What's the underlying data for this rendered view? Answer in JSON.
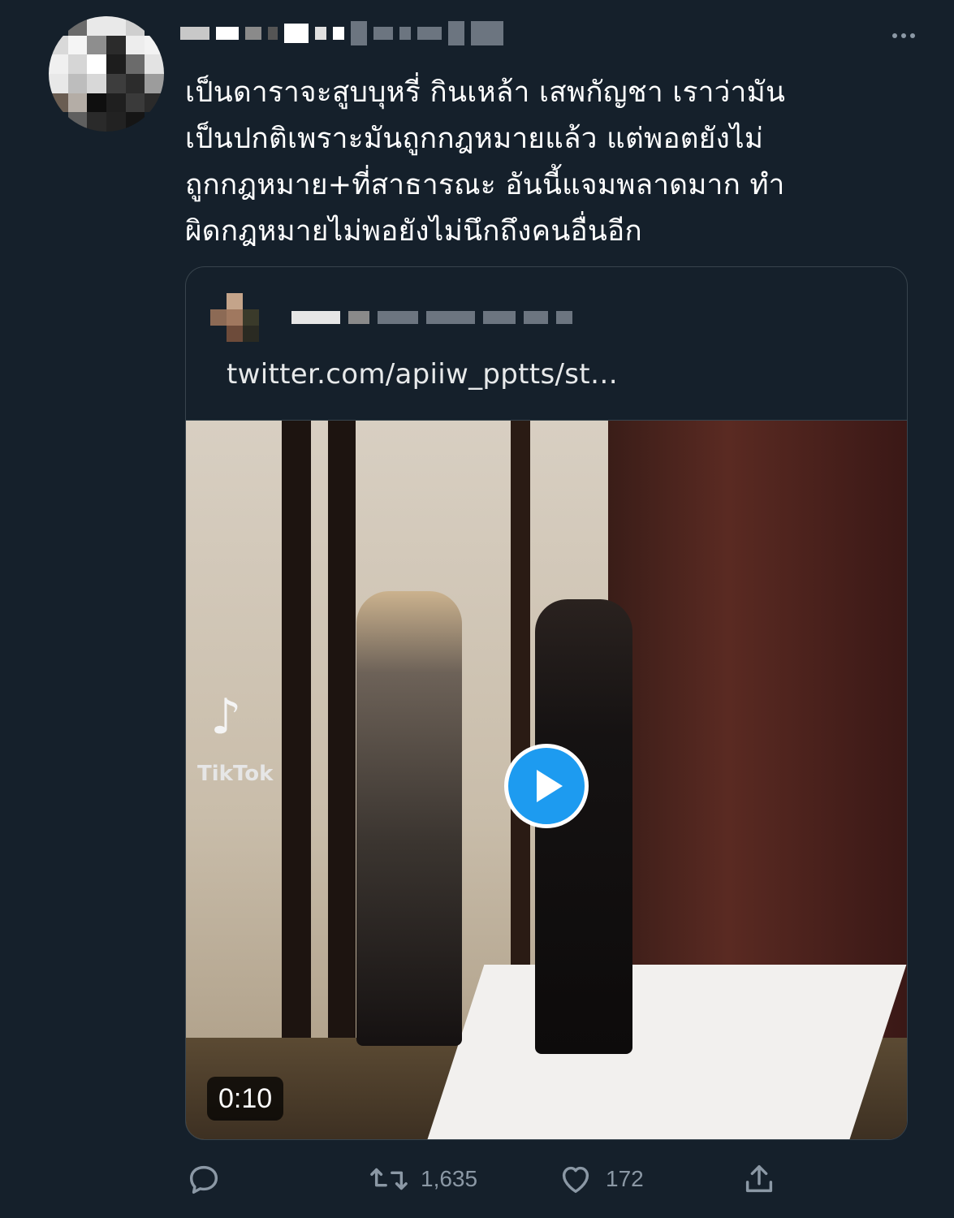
{
  "tweet": {
    "text": "เป็นดาราจะสูบบุหรี่ กินเหล้า เสพกัญชา เราว่ามัน\nเป็นปกติเพราะมันถูกกฎหมายแล้ว แต่พอตยังไม่\nถูกกฎหมาย+ที่สาธารณะ อันนี้แจมพลาดมาก ทำ\nผิดกฎหมายไม่พอยังไม่นึกถึงคนอื่นอีก"
  },
  "quote": {
    "link": "twitter.com/apiiw_pptts/st…",
    "video": {
      "duration": "0:10",
      "watermark_app": "TikTok"
    }
  },
  "actions": {
    "retweets": "1,635",
    "likes": "172"
  },
  "icons": {
    "more": "more-icon",
    "reply": "reply-icon",
    "retweet": "retweet-icon",
    "like": "heart-icon",
    "share": "share-icon",
    "play": "play-icon"
  },
  "colors": {
    "background": "#15202b",
    "accent": "#1d9bf0",
    "muted": "#8b98a5",
    "border": "#38444d"
  }
}
